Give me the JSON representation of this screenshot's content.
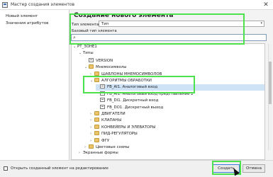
{
  "window": {
    "title": "Мастер создания элементов",
    "close_glyph": "✕"
  },
  "nav": {
    "items": [
      "Новый элемент",
      "Значения атрибутов"
    ]
  },
  "form": {
    "heading": "Создание нового элемента",
    "type_label": "Тип элемента",
    "type_value": "Тип",
    "base_type_label": "Базовый тип элемента",
    "search_placeholder": ""
  },
  "tree": {
    "rows": [
      {
        "label": "РТ_ЗОНЕ1",
        "indent": 0,
        "expanded": true,
        "icon": "none"
      },
      {
        "label": "Типы",
        "indent": 1,
        "expanded": true,
        "icon": "none"
      },
      {
        "label": "VERSION",
        "indent": 2,
        "expanded": null,
        "icon": "file-icon"
      },
      {
        "label": "Мнемосимволы",
        "indent": 2,
        "expanded": true,
        "icon": "folder-icon"
      },
      {
        "label": "ШАБЛОНЫ МНЕМОСИМВОЛОВ",
        "indent": 3,
        "expanded": false,
        "icon": "folder-icon"
      },
      {
        "label": "АЛГОРИТМЫ ОБРАБОТКИ",
        "indent": 3,
        "expanded": true,
        "icon": "folder-icon"
      },
      {
        "label": "FB_AI1. Аналоговый вход",
        "indent": 4,
        "expanded": null,
        "icon": "file-icon",
        "selected": true
      },
      {
        "label": "FB_AI1. Аналоговый вход представление 2",
        "indent": 4,
        "expanded": null,
        "icon": "file-icon"
      },
      {
        "label": "FB_DI1. Дискретный вход",
        "indent": 4,
        "expanded": null,
        "icon": "file-icon"
      },
      {
        "label": "FB_DO1. Дискретный выход",
        "indent": 4,
        "expanded": null,
        "icon": "file-icon"
      },
      {
        "label": "ДВИГАТЕЛИ",
        "indent": 3,
        "expanded": false,
        "icon": "folder-icon"
      },
      {
        "label": "КЛАПАНЫ",
        "indent": 3,
        "expanded": false,
        "icon": "folder-icon"
      },
      {
        "label": "КОНВЕЙЕРЫ И ЭЛЕВАТОРЫ",
        "indent": 3,
        "expanded": false,
        "icon": "folder-icon"
      },
      {
        "label": "ПИД-РЕГУЛЯТОРЫ",
        "indent": 3,
        "expanded": false,
        "icon": "folder-icon"
      },
      {
        "label": "ФГУ",
        "indent": 3,
        "expanded": false,
        "icon": "folder-icon"
      },
      {
        "label": "Цветовые схемы",
        "indent": 2,
        "expanded": false,
        "icon": "folder-icon"
      },
      {
        "label": "Экранные формы",
        "indent": 1,
        "expanded": false,
        "icon": "none"
      }
    ]
  },
  "footer": {
    "checkbox_label": "Открыть созданный элемент на редактирование",
    "checkbox_checked": false,
    "create_label": "Создать",
    "cancel_label": "Отмена"
  },
  "colors": {
    "highlight": "#4de24d",
    "selection": "#cfe3f7",
    "folder": "#e9c46a"
  }
}
